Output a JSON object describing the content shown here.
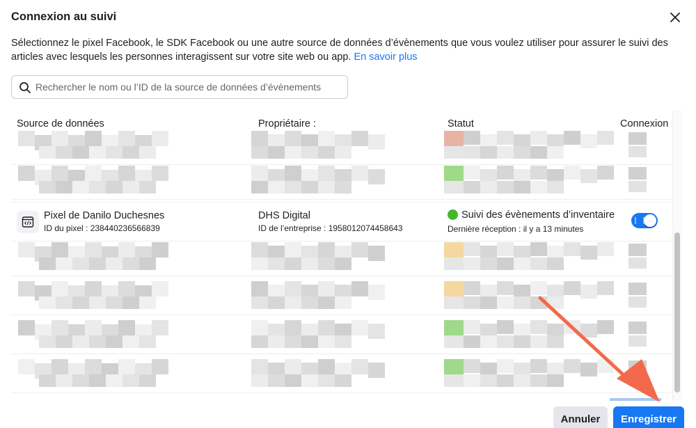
{
  "dialog": {
    "title": "Connexion au suivi",
    "description": "Sélectionnez le pixel Facebook, le SDK Facebook ou une autre source de données d’évènements que vous voulez utiliser pour assurer le suivi des articles avec lesquels les personnes interagissent sur votre site web ou app.",
    "learn_more": "En savoir plus",
    "close_icon": "close-icon"
  },
  "search": {
    "placeholder": "Rechercher le nom ou l’ID de la source de données d’évènements",
    "value": "",
    "icon": "search-icon"
  },
  "table": {
    "headers": {
      "source": "Source de données",
      "owner": "Propriétaire :",
      "status": "Statut",
      "connection": "Connexion"
    },
    "visible_row": {
      "icon": "code-icon",
      "name": "Pixel de Danilo Duchesnes",
      "pixel_id": "ID du pixel : 238440236566839",
      "owner": "DHS Digital",
      "owner_id": "ID de l’entreprise : 1958012074458643",
      "status": "Suivi des évènements d’inventaire",
      "status_color": "#42b72a",
      "last_received": "Dernière réception : il y a 13 minutes",
      "connected": true
    },
    "blurred_row_status_colors": [
      "#e9b3a4",
      "#9fd98a",
      "#f4d8a0",
      "#f4d8a0",
      "#9fd98a",
      "#9fd98a"
    ]
  },
  "footer": {
    "cancel_label": "Annuler",
    "save_label": "Enregistrer"
  },
  "colors": {
    "accent": "#1877f2",
    "annotation_arrow": "#f26a4b"
  }
}
